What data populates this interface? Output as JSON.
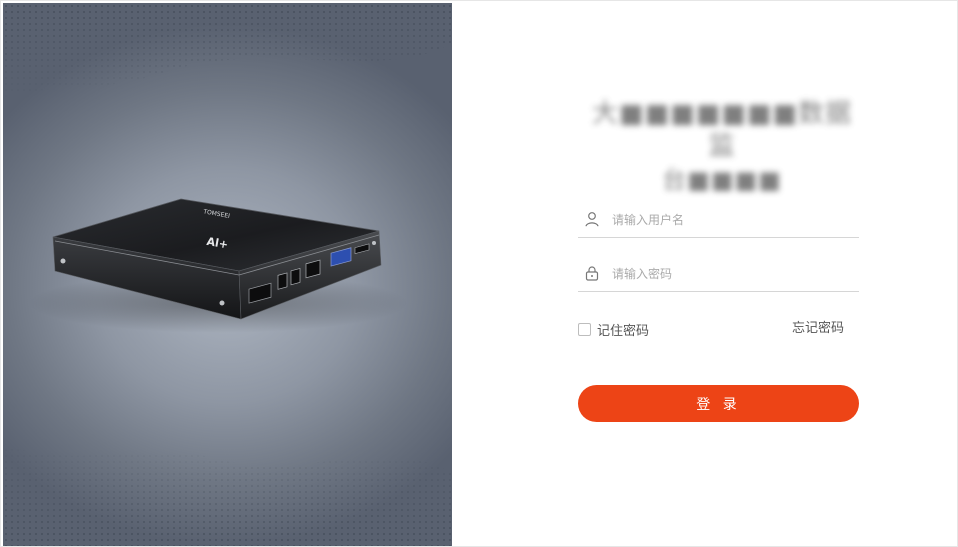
{
  "hero": {
    "image": "mini-pc-device",
    "device_label": "TOMSEEI",
    "device_logo": "Al+"
  },
  "login": {
    "title_line1": "大■■■■■■■数据监",
    "title_line2": "台■■■■",
    "username": {
      "placeholder": "请输入用户名",
      "value": "",
      "icon": "user-icon"
    },
    "password": {
      "placeholder": "请输入密码",
      "value": "",
      "icon": "lock-icon"
    },
    "remember_label": "记住密码",
    "remember_checked": false,
    "forgot_label": "忘记密码",
    "submit_label": "登 录"
  },
  "colors": {
    "accent": "#ed4416",
    "hero_bg": "#8e96a3"
  }
}
